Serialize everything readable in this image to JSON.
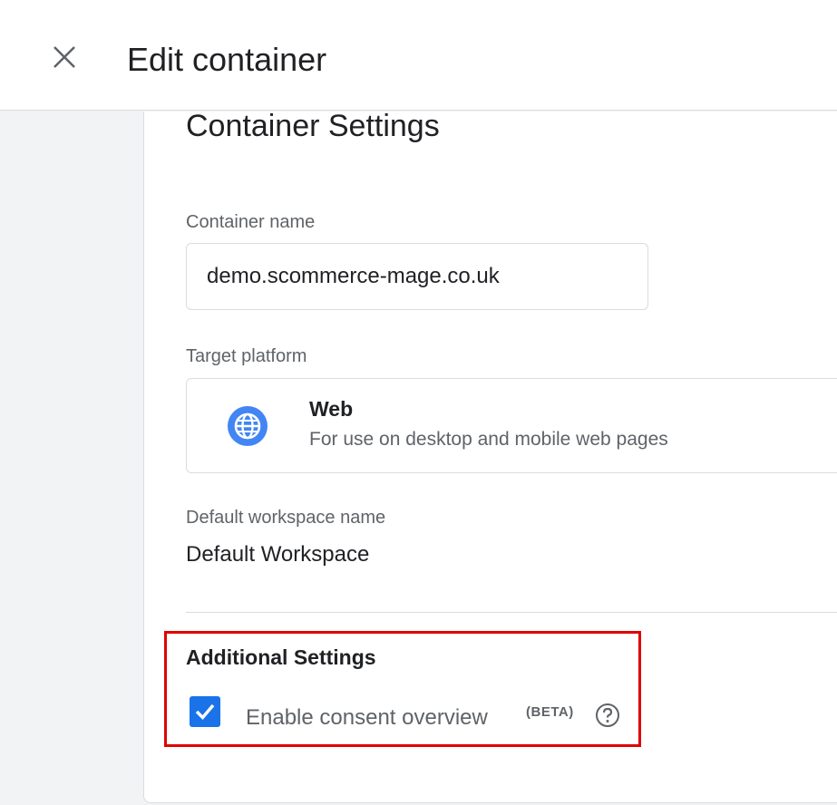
{
  "header": {
    "title": "Edit container",
    "close_icon": "close-icon"
  },
  "settings": {
    "section_title": "Container Settings",
    "container_name_label": "Container name",
    "container_name_value": "demo.scommerce-mage.co.uk",
    "target_platform_label": "Target platform",
    "platform": {
      "icon": "globe-icon",
      "name": "Web",
      "description": "For use on desktop and mobile web pages"
    },
    "workspace_label": "Default workspace name",
    "workspace_value": "Default Workspace"
  },
  "additional": {
    "title": "Additional Settings",
    "consent_label": "Enable consent overview",
    "beta_badge": "(BETA)",
    "consent_checked": true,
    "help_icon": "help-circle-icon"
  },
  "colors": {
    "accent": "#1a73e8",
    "highlight": "#e00000"
  }
}
